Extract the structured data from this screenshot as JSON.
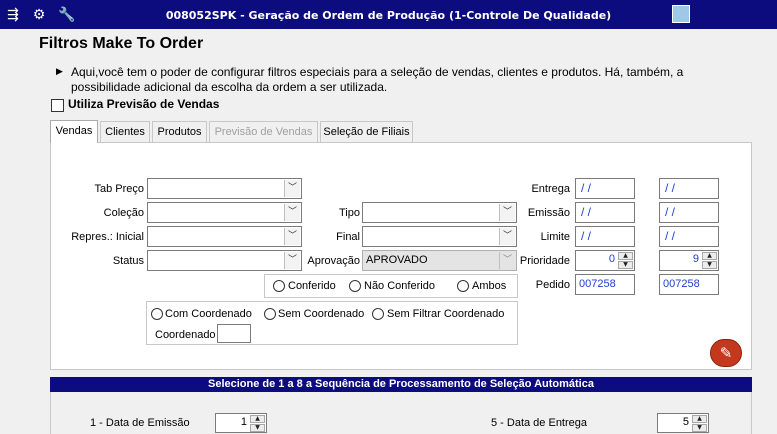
{
  "window": {
    "title": "008052SPK - Geração de Ordem de Produção (1-Controle De Qualidade)"
  },
  "header": {
    "title": "Filtros Make To Order",
    "description": "Aqui,você tem o poder de configurar filtros especiais para a seleção de vendas, clientes e produtos. Há, também, a possibilidade adicional da escolha da ordem a ser utilizada.",
    "use_forecast_label": "Utiliza Previsão de Vendas"
  },
  "tabs": [
    {
      "label": "Vendas"
    },
    {
      "label": "Clientes"
    },
    {
      "label": "Produtos"
    },
    {
      "label": "Previsão de Vendas"
    },
    {
      "label": "Seleção de Filiais"
    }
  ],
  "vendas": {
    "tab_preco_label": "Tab Preço",
    "colecao_label": "Coleção",
    "repres_label": "Repres.: Inicial",
    "status_label": "Status",
    "tipo_label": "Tipo",
    "final_label": "Final",
    "aprovacao_label": "Aprovação",
    "aprovacao_value": "APROVADO",
    "entrega_label": "Entrega",
    "emissao_label": "Emissão",
    "limite_label": "Limite",
    "prioridade_label": "Prioridade",
    "pedido_label": "Pedido",
    "date_empty": " / /",
    "prioridade_from": "0",
    "prioridade_to": "9",
    "pedido_from": "007258",
    "pedido_to": "007258",
    "radio_conferido": "Conferido",
    "radio_nao_conferido": "Não Conferido",
    "radio_ambos": "Ambos",
    "radio_com_coord": "Com Coordenado",
    "radio_sem_coord": "Sem Coordenado",
    "radio_sem_filtrar": "Sem Filtrar Coordenado",
    "coordenado_label": "Coordenado"
  },
  "sequence": {
    "title": "Selecione de 1 a 8 a Sequência de Processamento de Seleção Automática",
    "item1_label": "1 - Data de Emissão",
    "item1_value": "1",
    "item5_label": "5 - Data de Entrega",
    "item5_value": "5"
  },
  "colors": {
    "titlebar": "#0c0c7e",
    "value_blue": "#1d3fd0",
    "action_button": "#c4391d"
  }
}
